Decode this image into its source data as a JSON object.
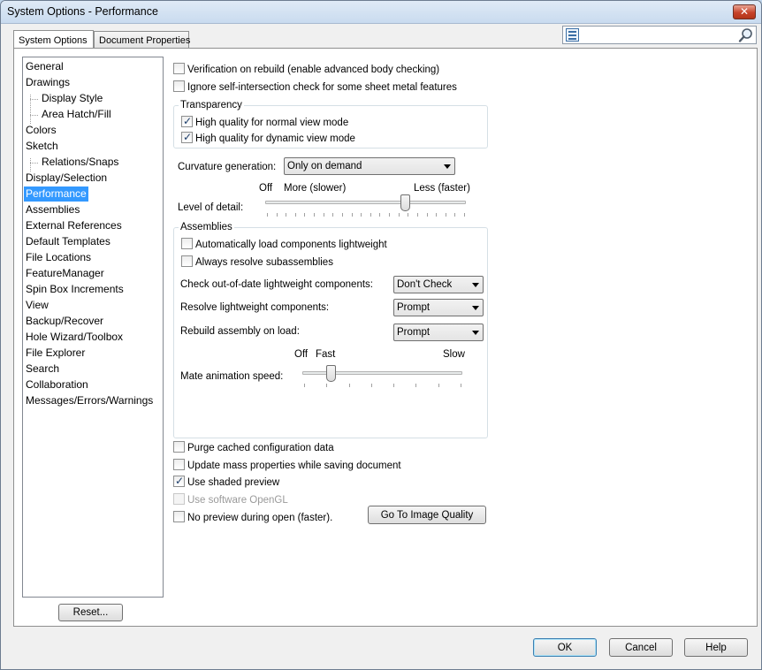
{
  "window": {
    "title": "System Options - Performance",
    "close_glyph": "✕"
  },
  "tabs": [
    {
      "label": "System Options",
      "active": true
    },
    {
      "label": "Document Properties",
      "active": false
    }
  ],
  "search": {
    "placeholder": "",
    "value": "",
    "list_icon": "list-icon",
    "search_icon": "magnifier-icon"
  },
  "tree": {
    "items": [
      {
        "label": "General"
      },
      {
        "label": "Drawings"
      },
      {
        "label": "Display Style"
      },
      {
        "label": "Area Hatch/Fill"
      },
      {
        "label": "Colors"
      },
      {
        "label": "Sketch"
      },
      {
        "label": "Relations/Snaps"
      },
      {
        "label": "Display/Selection"
      },
      {
        "label": "Performance",
        "selected": true
      },
      {
        "label": "Assemblies"
      },
      {
        "label": "External References"
      },
      {
        "label": "Default Templates"
      },
      {
        "label": "File Locations"
      },
      {
        "label": "FeatureManager"
      },
      {
        "label": "Spin Box Increments"
      },
      {
        "label": "View"
      },
      {
        "label": "Backup/Recover"
      },
      {
        "label": "Hole Wizard/Toolbox"
      },
      {
        "label": "File Explorer"
      },
      {
        "label": "Search"
      },
      {
        "label": "Collaboration"
      },
      {
        "label": "Messages/Errors/Warnings"
      }
    ],
    "selected_color": "#3399ff"
  },
  "reset_label": "Reset...",
  "options": {
    "verification": {
      "label": "Verification on rebuild (enable advanced body checking)",
      "checked": false
    },
    "ignore_self_intersection": {
      "label": "Ignore self-intersection check for some sheet metal features",
      "checked": false
    }
  },
  "transparency": {
    "title": "Transparency",
    "normal": {
      "label": "High quality for normal view mode",
      "checked": true
    },
    "dynamic": {
      "label": "High quality for dynamic view mode",
      "checked": true
    }
  },
  "curvature": {
    "label": "Curvature generation:",
    "value": "Only on demand"
  },
  "level_of_detail": {
    "label": "Level of detail:",
    "off_label": "Off",
    "more_label": "More (slower)",
    "less_label": "Less (faster)",
    "position_fraction": 0.7
  },
  "assemblies": {
    "title": "Assemblies",
    "auto_load": {
      "label": "Automatically load components lightweight",
      "checked": false
    },
    "always_resolve": {
      "label": "Always resolve subassemblies",
      "checked": false
    },
    "check_out_of_date": {
      "label": "Check out-of-date lightweight components:",
      "value": "Don't Check"
    },
    "resolve_lightweight": {
      "label": "Resolve lightweight components:",
      "value": "Prompt"
    },
    "rebuild_on_load": {
      "label": "Rebuild assembly on load:",
      "value": "Prompt"
    },
    "mate_animation": {
      "label": "Mate animation speed:",
      "off_label": "Off",
      "fast_label": "Fast",
      "slow_label": "Slow",
      "position_fraction": 0.18
    }
  },
  "misc": {
    "purge_cache": {
      "label": "Purge cached configuration data",
      "checked": false
    },
    "update_mass": {
      "label": "Update mass properties while saving document",
      "checked": false
    },
    "shaded_preview": {
      "label": "Use shaded preview",
      "checked": true
    },
    "software_opengl": {
      "label": "Use software OpenGL",
      "checked": false,
      "disabled": true
    },
    "no_preview": {
      "label": "No preview during open (faster).",
      "checked": false
    }
  },
  "image_quality_button": "Go To Image Quality",
  "footer": {
    "ok": "OK",
    "cancel": "Cancel",
    "help": "Help"
  }
}
